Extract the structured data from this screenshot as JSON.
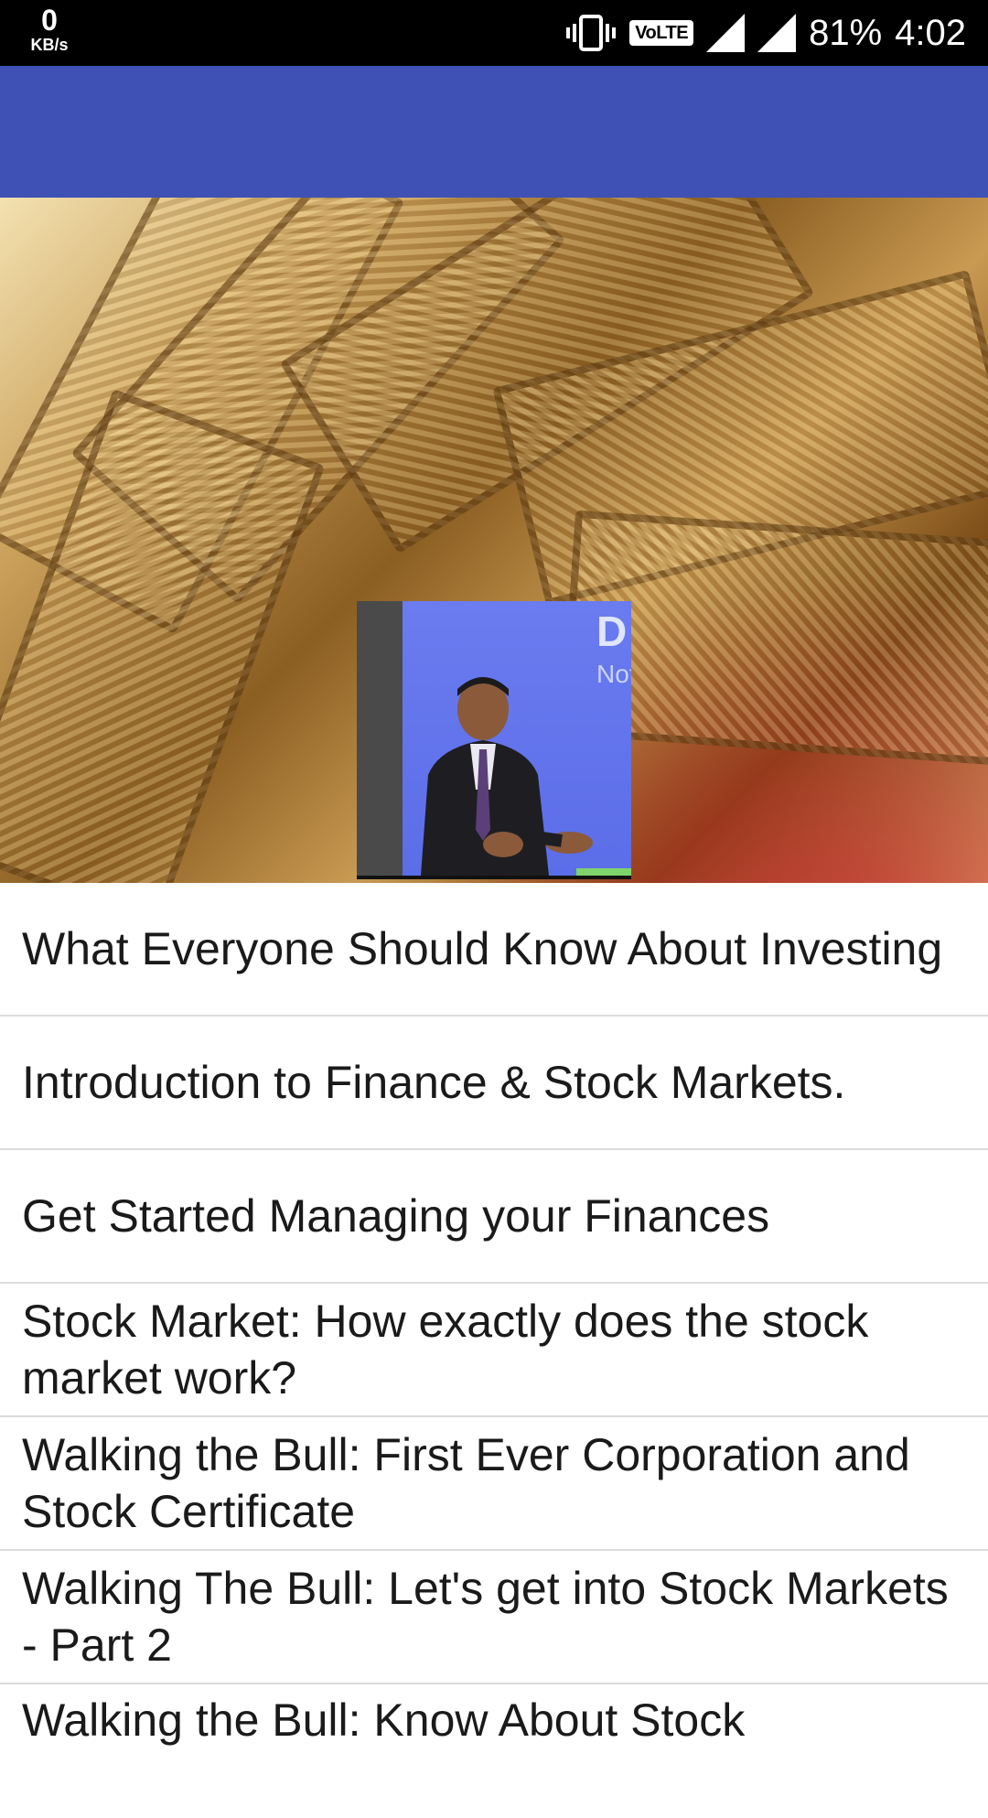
{
  "status_bar": {
    "net_speed_value": "0",
    "net_speed_unit": "KB/s",
    "volte_label": "VoLTE",
    "battery_percent": "81%",
    "time": "4:02",
    "icons": [
      "vibrate-icon",
      "signal-icon",
      "signal-icon",
      "battery-icon"
    ]
  },
  "app_bar": {
    "title": ""
  },
  "hero": {
    "background": "money-bills-image",
    "photo": "speaker-photo",
    "photo_screen_text": [
      "D",
      "Not"
    ]
  },
  "articles": [
    {
      "title": "What Everyone Should Know About Investing"
    },
    {
      "title": "Introduction to Finance & Stock Markets."
    },
    {
      "title": "Get Started Managing your Finances"
    },
    {
      "title": "Stock Market: How exactly does the stock market work?"
    },
    {
      "title": "Walking the Bull: First Ever Corporation and Stock Certificate"
    },
    {
      "title": "Walking The Bull: Let's get into Stock Markets - Part 2"
    },
    {
      "title": "Walking the Bull: Know About Stock"
    }
  ],
  "colors": {
    "status_bar": "#000000",
    "app_bar": "#3f51b5",
    "divider": "#dcdcdc",
    "text": "#1a1a1a"
  }
}
